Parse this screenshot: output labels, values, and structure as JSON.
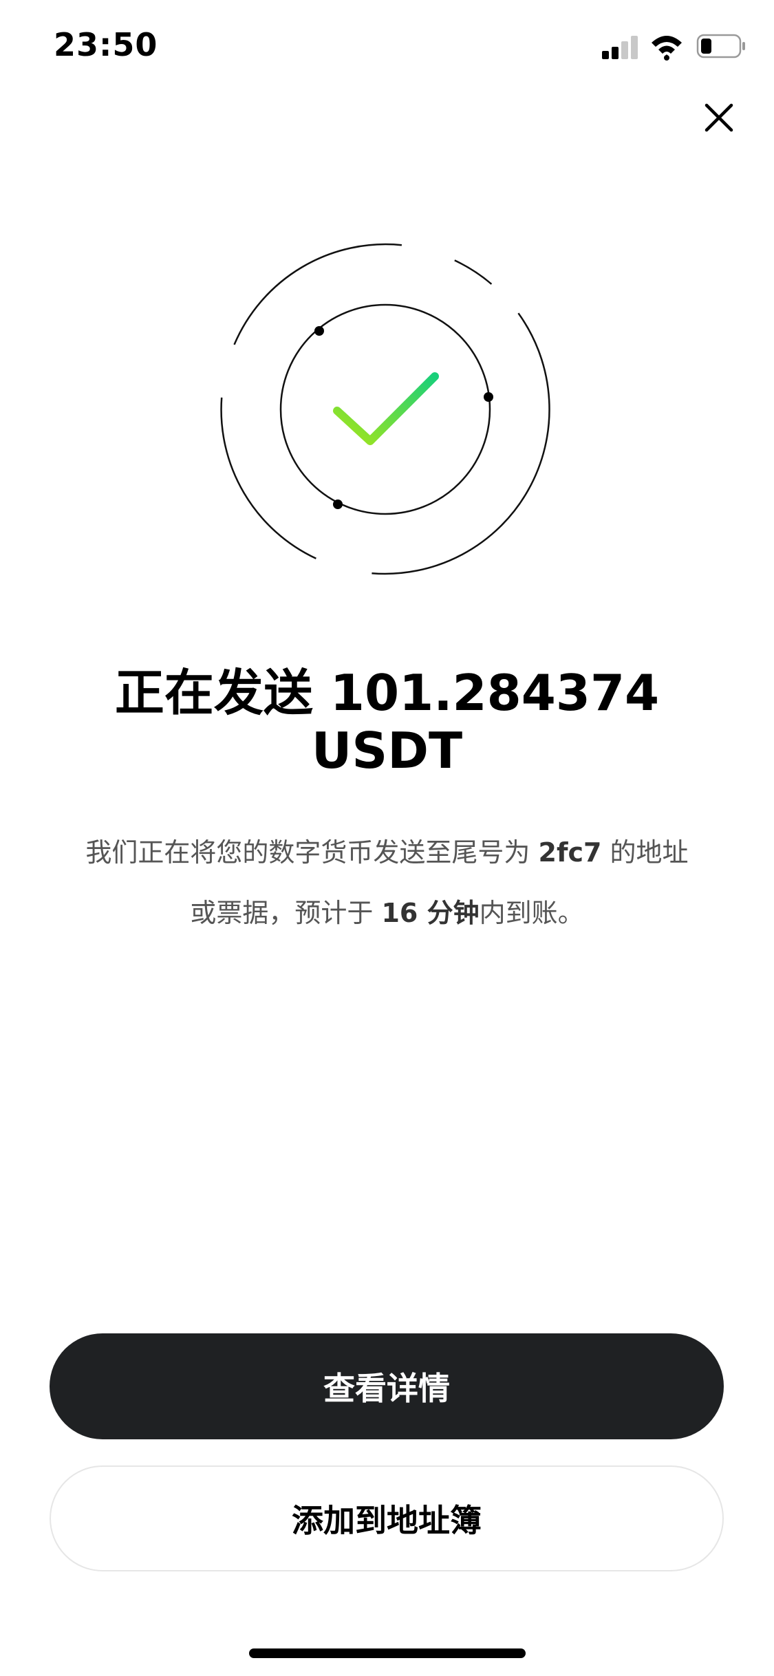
{
  "status_bar": {
    "time": "23:50",
    "icons": [
      "signal-icon",
      "wifi-icon",
      "battery-icon"
    ]
  },
  "header": {
    "close_icon": "close-icon"
  },
  "success_graphic": {
    "icon": "checkmark-icon",
    "colors": {
      "check_start": "#a6e61a",
      "check_end": "#19cf7a",
      "rings": "#111111"
    }
  },
  "main": {
    "title_line1": "正在发送 101.284374",
    "title_line2": "USDT",
    "desc": {
      "part1": "我们正在将您的数字货币发送至尾号为 ",
      "address_suffix": "2fc7",
      "part2": " 的地址或票据，预计于 ",
      "eta": "16 分钟",
      "part3": "内到账。"
    }
  },
  "actions": {
    "view_details_label": "查看详情",
    "add_to_address_book_label": "添加到地址簿"
  },
  "colors": {
    "primary_button": "#1f2123",
    "text_secondary": "#555555"
  }
}
